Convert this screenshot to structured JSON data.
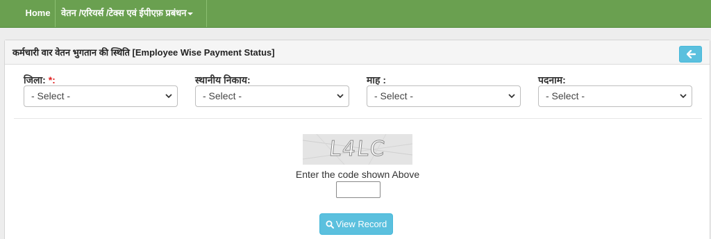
{
  "navbar": {
    "home_label": "Home",
    "menu_label": "वेतन /एरियर्स /टेक्स एवं ईपीएफ़ प्रबंधन"
  },
  "panel": {
    "title": "कर्मचारी वार वेतन भुगतान की स्थिति [Employee Wise Payment Status]",
    "back_icon": "arrow-left-icon"
  },
  "filters": [
    {
      "label": "जिला:",
      "required_mark": "*:",
      "selected": "- Select -"
    },
    {
      "label": "स्थानीय निकाय:",
      "selected": "- Select -"
    },
    {
      "label": "माह :",
      "selected": "- Select -"
    },
    {
      "label": "पदनाम:",
      "selected": "- Select -"
    }
  ],
  "captcha": {
    "code": "L4LC",
    "hint": "Enter the code shown Above",
    "input_value": ""
  },
  "actions": {
    "view_label": "View Record",
    "view_icon": "search-icon"
  },
  "colors": {
    "navbar": "#6aa050",
    "info_button": "#5bc0de",
    "required": "#e02020"
  }
}
